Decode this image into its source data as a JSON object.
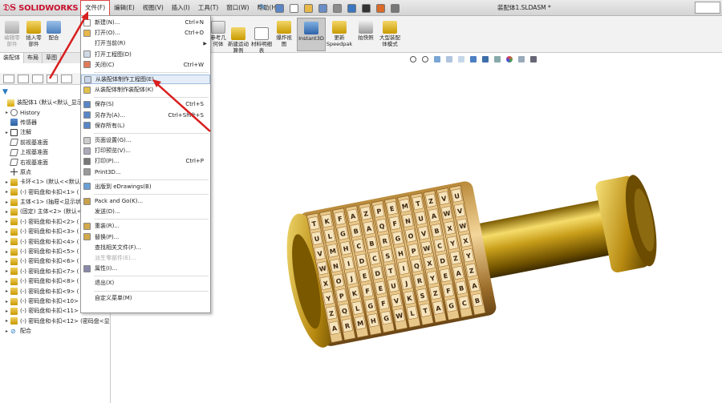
{
  "app": {
    "brand": "SOLIDWORKS",
    "window_title": "装配体1.SLDASM *"
  },
  "menubar": [
    {
      "label": "文件(F)",
      "active": true
    },
    {
      "label": "编辑(E)"
    },
    {
      "label": "视图(V)"
    },
    {
      "label": "插入(I)"
    },
    {
      "label": "工具(T)"
    },
    {
      "label": "窗口(W)"
    },
    {
      "label": "帮助(H)"
    }
  ],
  "quick_access": [
    "home-icon",
    "new-document-icon",
    "open-icon",
    "save-icon",
    "print-icon",
    "undo-icon",
    "select-icon",
    "rebuild-icon",
    "options-icon"
  ],
  "toolbar": {
    "edit_component": "编辑零部件",
    "insert_component": "插入零部件",
    "mate": "配合",
    "reference_geometry": "参考几何体",
    "new_motion_study": "新建运动算例",
    "bom": "材料明细表",
    "exploded_view": "爆炸视图",
    "instant3d": "Instant3D",
    "update_speedpak": "更新Speedpak",
    "snapshot": "拍快照",
    "large_assembly": "大型装配体模式"
  },
  "command_tabs": [
    "装配体",
    "布局",
    "草图"
  ],
  "file_menu": [
    {
      "label": "新建(N)...",
      "shortcut": "Ctrl+N",
      "icon": "new-icon"
    },
    {
      "label": "打开(O)...",
      "shortcut": "Ctrl+O",
      "icon": "open-icon"
    },
    {
      "label": "打开当前(R)",
      "submenu": true
    },
    {
      "label": "打开工程图(D)",
      "icon": "open-drawing-icon"
    },
    {
      "label": "关闭(C)",
      "shortcut": "Ctrl+W",
      "icon": "close-icon"
    },
    {
      "sep": true
    },
    {
      "label": "从装配体制作工程图(E)",
      "icon": "make-drawing-icon",
      "highlight": true
    },
    {
      "label": "从装配体制作装配体(K)",
      "icon": "make-assembly-icon"
    },
    {
      "sep": true
    },
    {
      "label": "保存(S)",
      "shortcut": "Ctrl+S",
      "icon": "save-icon"
    },
    {
      "label": "另存为(A)...",
      "shortcut": "Ctrl+Shift+S",
      "icon": "save-as-icon"
    },
    {
      "label": "保存所有(L)",
      "icon": "save-all-icon"
    },
    {
      "sep": true
    },
    {
      "label": "页面设置(G)...",
      "icon": "page-setup-icon"
    },
    {
      "label": "打印预览(V)...",
      "icon": "print-preview-icon"
    },
    {
      "label": "打印(P)...",
      "shortcut": "Ctrl+P",
      "icon": "print-icon"
    },
    {
      "label": "Print3D...",
      "icon": "print3d-icon"
    },
    {
      "sep": true
    },
    {
      "label": "出版到 eDrawings(B)",
      "icon": "edrawings-icon"
    },
    {
      "sep": true
    },
    {
      "label": "Pack and Go(K)...",
      "icon": "pack-and-go-icon"
    },
    {
      "label": "发送(D)..."
    },
    {
      "sep": true
    },
    {
      "label": "重装(R)...",
      "icon": "reload-icon"
    },
    {
      "label": "替换(P)...",
      "icon": "replace-icon"
    },
    {
      "label": "查找相关文件(F)..."
    },
    {
      "label": "派生零部件(E)...",
      "disabled": true
    },
    {
      "label": "属性(I)...",
      "icon": "properties-icon"
    },
    {
      "sep": true
    },
    {
      "label": "退出(X)"
    },
    {
      "sep": true
    },
    {
      "label": "自定义菜单(M)"
    }
  ],
  "feature_tree": [
    {
      "label": "装配体1 (默认<默认_显示状",
      "icon": "top",
      "expander": ""
    },
    {
      "label": "History",
      "icon": "hist",
      "expander": "▸"
    },
    {
      "label": "传感器",
      "icon": "sensor",
      "expander": ""
    },
    {
      "label": "注解",
      "icon": "anno",
      "expander": "▸"
    },
    {
      "label": "前视基准面",
      "icon": "plane",
      "expander": ""
    },
    {
      "label": "上视基准面",
      "icon": "plane",
      "expander": ""
    },
    {
      "label": "右视基准面",
      "icon": "plane",
      "expander": ""
    },
    {
      "label": "原点",
      "icon": "origin",
      "expander": ""
    },
    {
      "label": "卡环<1> (默认<<默认",
      "icon": "part",
      "expander": "▸"
    },
    {
      "label": "(-) 密码盘和卡扣<1> (",
      "icon": "part",
      "expander": "▸"
    },
    {
      "label": "主体<1> (抽屉<显示状",
      "icon": "part",
      "expander": "▸"
    },
    {
      "label": "(固定) 主体<2> (默认<",
      "icon": "part",
      "expander": "▸"
    },
    {
      "label": "(-) 密码盘和卡扣<2> (",
      "icon": "part",
      "expander": "▸"
    },
    {
      "label": "(-) 密码盘和卡扣<3> (",
      "icon": "part",
      "expander": "▸"
    },
    {
      "label": "(-) 密码盘和卡扣<4> (",
      "icon": "part",
      "expander": "▸"
    },
    {
      "label": "(-) 密码盘和卡扣<5> (",
      "icon": "part",
      "expander": "▸"
    },
    {
      "label": "(-) 密码盘和卡扣<6> (",
      "icon": "part",
      "expander": "▸"
    },
    {
      "label": "(-) 密码盘和卡扣<7> (",
      "icon": "part",
      "expander": "▸"
    },
    {
      "label": "(-) 密码盘和卡扣<8> (",
      "icon": "part",
      "expander": "▸"
    },
    {
      "label": "(-) 密码盘和卡扣<9> (",
      "icon": "part",
      "expander": "▸"
    },
    {
      "label": "(-) 密码盘和卡扣<10>",
      "icon": "part",
      "expander": "▸"
    },
    {
      "label": "(-) 密码盘和卡扣<11>",
      "icon": "part",
      "expander": "▸"
    },
    {
      "label": "(-) 密码盘和卡扣<12> (密码盘<显",
      "icon": "part",
      "expander": "▸"
    },
    {
      "label": "配合",
      "icon": "mate",
      "expander": "▸"
    }
  ],
  "cylinder_letters": [
    [
      "T",
      "U",
      "V",
      "W",
      "X",
      "Y",
      "Z",
      "A"
    ],
    [
      "K",
      "L",
      "M",
      "N",
      "O",
      "P",
      "Q",
      "R"
    ],
    [
      "F",
      "G",
      "H",
      "I",
      "J",
      "K",
      "L",
      "M"
    ],
    [
      "A",
      "B",
      "C",
      "D",
      "E",
      "F",
      "G",
      "H"
    ],
    [
      "Z",
      "A",
      "B",
      "C",
      "D",
      "E",
      "F",
      "G"
    ],
    [
      "P",
      "Q",
      "R",
      "S",
      "T",
      "U",
      "V",
      "W"
    ],
    [
      "E",
      "F",
      "G",
      "H",
      "I",
      "J",
      "K",
      "L"
    ],
    [
      "M",
      "N",
      "O",
      "P",
      "Q",
      "R",
      "S",
      "T"
    ],
    [
      "T",
      "U",
      "V",
      "W",
      "X",
      "Y",
      "Z",
      "A"
    ],
    [
      "Z",
      "A",
      "B",
      "C",
      "D",
      "E",
      "F",
      "G"
    ],
    [
      "V",
      "W",
      "X",
      "Y",
      "Z",
      "A",
      "B",
      "C"
    ],
    [
      "U",
      "V",
      "W",
      "X",
      "Y",
      "Z",
      "A",
      "B"
    ]
  ],
  "colors": {
    "highlight": "#e4edf8",
    "arrow": "#d81e1e",
    "brand": "#c8102e"
  }
}
